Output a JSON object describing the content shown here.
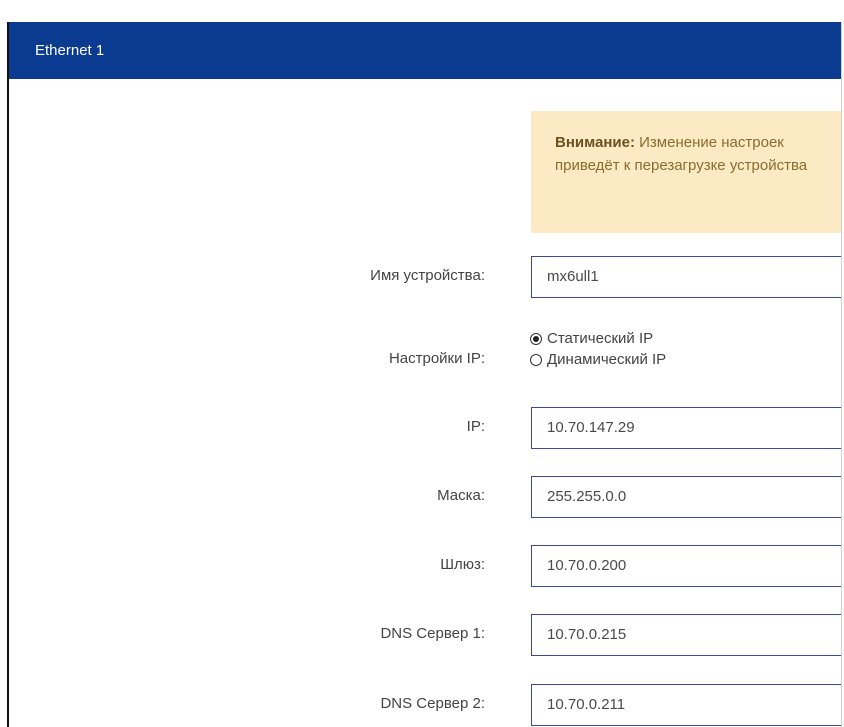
{
  "window": {
    "title": "Ethernet 1"
  },
  "warning": {
    "strong": "Внимание:",
    "text": " Изменение настроек приведёт к перезагрузке устройства"
  },
  "form": {
    "device_name": {
      "label": "Имя устройства:",
      "value": "mx6ull1"
    },
    "ip_settings": {
      "label": "Настройки IP:",
      "options": [
        {
          "label": "Статический IP",
          "selected": true
        },
        {
          "label": "Динамический IP",
          "selected": false
        }
      ]
    },
    "ip": {
      "label": "IP:",
      "value": "10.70.147.29"
    },
    "mask": {
      "label": "Маска:",
      "value": "255.255.0.0"
    },
    "gateway": {
      "label": "Шлюз:",
      "value": "10.70.0.200"
    },
    "dns1": {
      "label": "DNS Сервер 1:",
      "value": "10.70.0.215"
    },
    "dns2": {
      "label": "DNS Сервер 2:",
      "value": "10.70.0.211"
    }
  },
  "colors": {
    "header": "#0b3a91",
    "warning_bg": "#fbeac3",
    "input_border": "#3b4a9e"
  }
}
